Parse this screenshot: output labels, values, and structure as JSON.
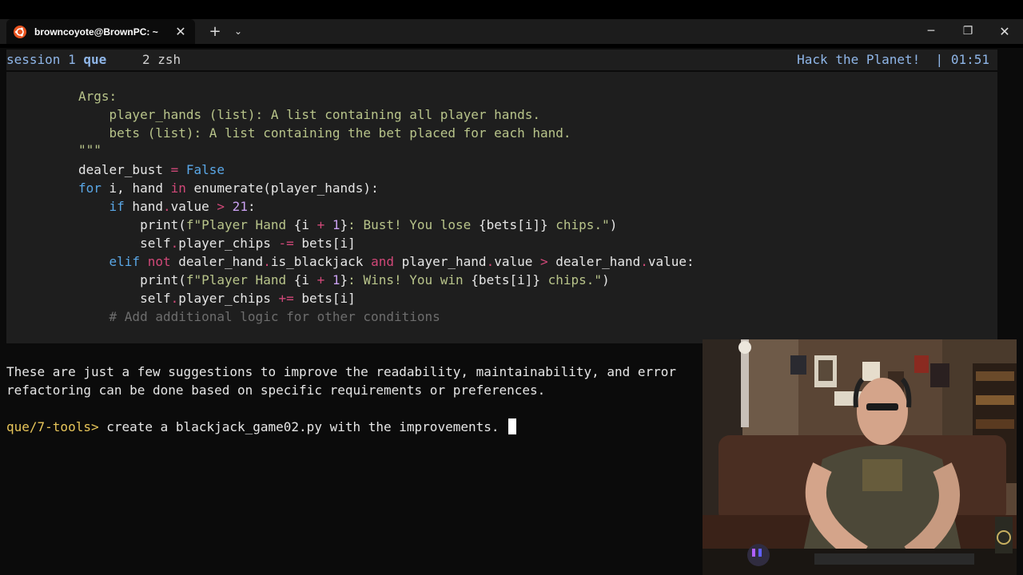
{
  "window": {
    "tab_title": "browncoyote@BrownPC: ~",
    "tab_close": "✕",
    "new_tab": "+",
    "dropdown": "⌄",
    "minimize": "─",
    "maximize": "❐",
    "close": "✕"
  },
  "tmux": {
    "session_label": "session 1",
    "session_name": "que",
    "window_2": "2 zsh",
    "right_status": "Hack the Planet!",
    "separator": "|",
    "clock": "01:51"
  },
  "code": {
    "line1": "Args:",
    "line2": "    player_hands (list): A list containing all player hands.",
    "line3": "    bets (list): A list containing the bet placed for each hand.",
    "line4": "\"\"\"",
    "line5_a": "dealer_bust ",
    "line5_op": "=",
    "line5_b": " False",
    "line6_for": "for",
    "line6_a": " i, hand ",
    "line6_in": "in",
    "line6_b": " enumerate(player_hands):",
    "line7_if": "    if",
    "line7_a": " hand",
    "line7_dot": ".",
    "line7_b": "value ",
    "line7_gt": ">",
    "line7_num": " 21",
    "line7_c": ":",
    "line8_a": "        print(",
    "line8_f": "f\"Player Hand ",
    "line8_br1": "{i ",
    "line8_plus": "+",
    "line8_num": " 1",
    "line8_br2": "}",
    "line8_s2": ": Bust! You lose ",
    "line8_br3": "{bets[i]}",
    "line8_s3": " chips.\"",
    "line8_end": ")",
    "line9_a": "        self",
    "line9_dot": ".",
    "line9_b": "player_chips ",
    "line9_op": "-=",
    "line9_c": " bets[i]",
    "line10_elif": "    elif",
    "line10_not": " not",
    "line10_a": " dealer_hand",
    "line10_dot1": ".",
    "line10_b": "is_blackjack ",
    "line10_and": "and",
    "line10_c": " player_hand",
    "line10_dot2": ".",
    "line10_d": "value ",
    "line10_gt": ">",
    "line10_e": " dealer_hand",
    "line10_dot3": ".",
    "line10_f": "value:",
    "line11_a": "        print(",
    "line11_f": "f\"Player Hand ",
    "line11_br1": "{i ",
    "line11_plus": "+",
    "line11_num": " 1",
    "line11_br2": "}",
    "line11_s2": ": Wins! You win ",
    "line11_br3": "{bets[i]}",
    "line11_s3": " chips.\"",
    "line11_end": ")",
    "line12_a": "        self",
    "line12_dot": ".",
    "line12_b": "player_chips ",
    "line12_op": "+=",
    "line12_c": " bets[i]",
    "line13": "    # Add additional logic for other conditions"
  },
  "terminal": {
    "text_line1": "These are just a few suggestions to improve the readability, maintainability, and error",
    "text_line2": "refactoring can be done based on specific requirements or preferences.",
    "prompt": "que/7-tools>",
    "command": " create a blackjack_game02.py with the improvements. "
  },
  "colors": {
    "prompt": "#e8c65a",
    "keyword": "#5aa7e6",
    "operator": "#d04878",
    "docstring": "#b8c48a",
    "comment": "#6d6d6d",
    "tmux_accent": "#8fb6e8"
  }
}
